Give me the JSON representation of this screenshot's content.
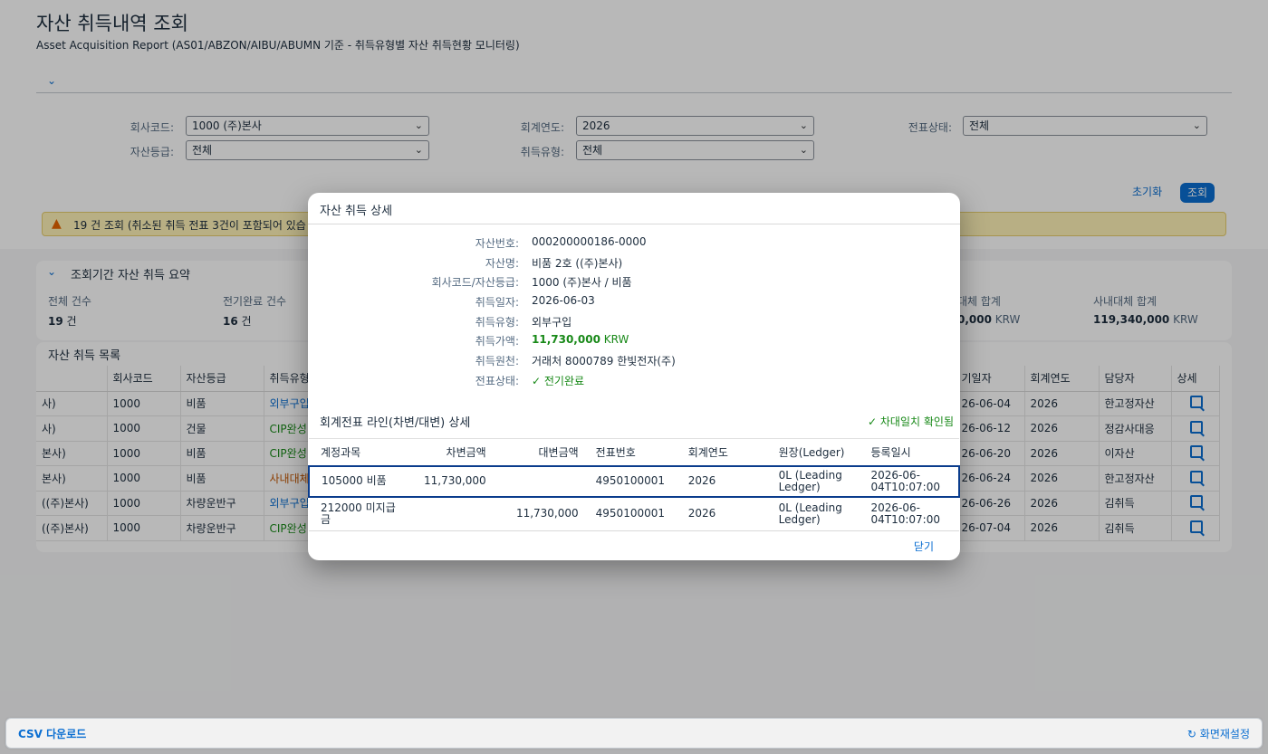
{
  "page": {
    "title": "자산 취득내역 조회",
    "subtitle": "Asset Acquisition Report (AS01/ABZON/AIBU/ABUMN 기준 - 취득유형별 자산 취득현황 모니터링)"
  },
  "filters": {
    "company_label": "회사코드:",
    "company_value": "1000 (주)본사",
    "fiscal_year_label": "회계연도:",
    "fiscal_year_value": "2026",
    "doc_status_label": "전표상태:",
    "doc_status_value": "전체",
    "asset_class_label": "자산등급:",
    "asset_class_value": "전체",
    "acq_type_label": "취득유형:",
    "acq_type_value": "전체",
    "reset_label": "초기화",
    "search_label": "조회"
  },
  "warning": {
    "text": "19 건 조회 (취소된 취득 전표 3건이 포함되어 있습"
  },
  "summary": {
    "title": "조회기간 자산 취득 요약",
    "total_label": "전체 건수",
    "total_value": "19",
    "total_unit": "건",
    "posted_label": "전기완료 건수",
    "posted_value": "16",
    "posted_unit": "건",
    "transfer_label": "대체 합계",
    "transfer_value": "0,000",
    "transfer_unit": "KRW",
    "internal_label": "사내대체 합계",
    "internal_value": "119,340,000",
    "internal_unit": "KRW"
  },
  "list": {
    "title": "자산 취득 목록",
    "headers": {
      "asset_name": "",
      "company": "회사코드",
      "asset_class": "자산등급",
      "acq_type": "취득유형",
      "acq_date": "기일자",
      "fiscal_year": "회계연도",
      "owner": "담당자",
      "detail": "상세"
    },
    "rows": [
      {
        "name": "사)",
        "company": "1000",
        "class": "비품",
        "type": "외부구입",
        "date": "26-06-04",
        "year": "2026",
        "owner": "한고정자산"
      },
      {
        "name": "사)",
        "company": "1000",
        "class": "건물",
        "type": "CIP완성",
        "date": "26-06-12",
        "year": "2026",
        "owner": "정감사대응"
      },
      {
        "name": "본사)",
        "company": "1000",
        "class": "비품",
        "type": "CIP완성",
        "date": "26-06-20",
        "year": "2026",
        "owner": "이자산"
      },
      {
        "name": "본사)",
        "company": "1000",
        "class": "비품",
        "type": "사내대체",
        "date": "26-06-24",
        "year": "2026",
        "owner": "한고정자산"
      },
      {
        "name": "((주)본사)",
        "company": "1000",
        "class": "차량운반구",
        "type": "외부구입",
        "date": "26-06-26",
        "year": "2026",
        "owner": "김취득"
      },
      {
        "name": "((주)본사)",
        "company": "1000",
        "class": "차량운반구",
        "type": "CIP완성",
        "date": "26-07-04",
        "year": "2026",
        "owner": "김취득"
      }
    ]
  },
  "dialog": {
    "title": "자산 취득 상세",
    "asset_no_label": "자산번호:",
    "asset_no": "000200000186-0000",
    "asset_name_label": "자산명:",
    "asset_name": "비품 2호 ((주)본사)",
    "company_class_label": "회사코드/자산등급:",
    "company_class": "1000 (주)본사 / 비품",
    "acq_date_label": "취득일자:",
    "acq_date": "2026-06-03",
    "acq_type_label": "취득유형:",
    "acq_type": "외부구입",
    "acq_amount_label": "취득가액:",
    "acq_amount": "11,730,000",
    "acq_amount_unit": "KRW",
    "acq_source_label": "취득원천:",
    "acq_source": "거래처 8000789 한빛전자(주)",
    "doc_status_label": "전표상태:",
    "doc_status": "전기완료",
    "lines_title": "회계전표 라인(차변/대변) 상세",
    "balance_status": "차대일치 확인됨",
    "line_headers": {
      "account": "계정과목",
      "debit": "차변금액",
      "credit": "대변금액",
      "doc_no": "전표번호",
      "year": "회계연도",
      "ledger": "원장(Ledger)",
      "created": "등록일시"
    },
    "lines": [
      {
        "account": "105000 비품",
        "debit": "11,730,000",
        "credit": "",
        "doc_no": "4950100001",
        "year": "2026",
        "ledger": "0L (Leading Ledger)",
        "created": "2026-06-04T10:07:00"
      },
      {
        "account": "212000 미지급금",
        "debit": "",
        "credit": "11,730,000",
        "doc_no": "4950100001",
        "year": "2026",
        "ledger": "0L (Leading Ledger)",
        "created": "2026-06-04T10:07:00"
      }
    ],
    "close_label": "닫기"
  },
  "footer": {
    "csv_label": "CSV 다운로드",
    "reset_view_label": "화면재설정"
  },
  "colors": {
    "accent": "#0a6ed1",
    "positive": "#188918",
    "warning": "#e76500",
    "warning_bg": "#fff3b8"
  }
}
